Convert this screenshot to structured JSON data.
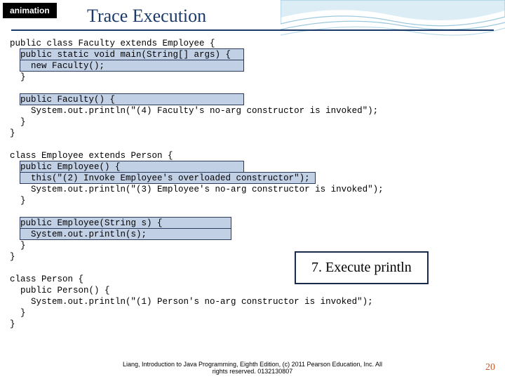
{
  "tag": "animation",
  "title": "Trace Execution",
  "code": "public class Faculty extends Employee {\n  public static void main(String[] args) {\n    new Faculty();\n  }\n\n  public Faculty() {\n    System.out.println(\"(4) Faculty's no-arg constructor is invoked\");\n  }\n}\n\nclass Employee extends Person {\n  public Employee() {\n    this(\"(2) Invoke Employee's overloaded constructor\");\n    System.out.println(\"(3) Employee's no-arg constructor is invoked\");\n  }\n\n  public Employee(String s) {\n    System.out.println(s);\n  }\n}\n\nclass Person {\n  public Person() {\n    System.out.println(\"(1) Person's no-arg constructor is invoked\");\n  }\n}",
  "callout": "7. Execute println",
  "footer_line1": "Liang, Introduction to Java Programming, Eighth Edition, (c) 2011 Pearson Education, Inc. All",
  "footer_line2": "rights reserved. 0132130807",
  "page_number": "20",
  "highlights_note": "Highlighted lines: 'public static void main(String[] args) {', 'new Faculty();', 'public Faculty() {', 'public Employee() {', 'this(\"(2) Invoke Employee's overloaded constructor\");', 'public Employee(String s) {', 'System.out.println(s);'"
}
